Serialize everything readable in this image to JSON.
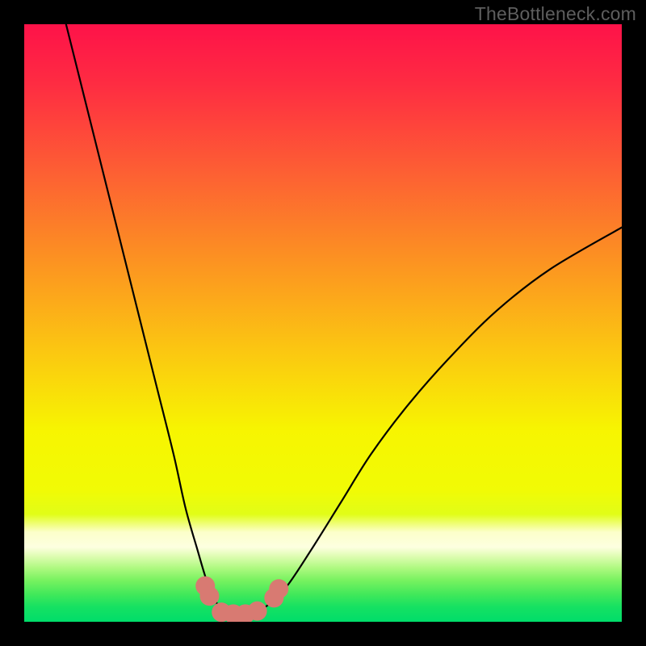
{
  "watermark": "TheBottleneck.com",
  "chart_data": {
    "type": "line",
    "title": "",
    "xlabel": "",
    "ylabel": "",
    "xlim": [
      0,
      100
    ],
    "ylim": [
      0,
      100
    ],
    "grid": false,
    "legend": false,
    "series": [
      {
        "name": "bottleneck-curve",
        "x": [
          7,
          10,
          13,
          16,
          19,
          22,
          25,
          27,
          29,
          30.5,
          32,
          33.5,
          35,
          37,
          39,
          41,
          44,
          48,
          53,
          58,
          64,
          71,
          79,
          88,
          100
        ],
        "y": [
          100,
          88,
          76,
          64,
          52,
          40,
          28,
          19,
          12,
          7,
          3.5,
          1.5,
          1.2,
          1.2,
          1.6,
          3.0,
          6,
          12,
          20,
          28,
          36,
          44,
          52,
          59,
          66
        ]
      }
    ],
    "markers": [
      {
        "name": "flat-zone-left-a",
        "x": 30.3,
        "y": 6.0
      },
      {
        "name": "flat-zone-left-b",
        "x": 31.0,
        "y": 4.3
      },
      {
        "name": "flat-zone-mid-a",
        "x": 33.0,
        "y": 1.6
      },
      {
        "name": "flat-zone-mid-b",
        "x": 35.0,
        "y": 1.3
      },
      {
        "name": "flat-zone-mid-c",
        "x": 37.0,
        "y": 1.3
      },
      {
        "name": "flat-zone-mid-d",
        "x": 39.0,
        "y": 1.8
      },
      {
        "name": "flat-zone-right-a",
        "x": 41.8,
        "y": 4.0
      },
      {
        "name": "flat-zone-right-b",
        "x": 42.6,
        "y": 5.5
      }
    ],
    "marker_color": "#d87a72",
    "marker_radius": 12,
    "gradient_stops": [
      {
        "offset": 0.0,
        "color": "#fe1249"
      },
      {
        "offset": 0.1,
        "color": "#fe2c42"
      },
      {
        "offset": 0.25,
        "color": "#fd6033"
      },
      {
        "offset": 0.4,
        "color": "#fc9421"
      },
      {
        "offset": 0.55,
        "color": "#fbc811"
      },
      {
        "offset": 0.68,
        "color": "#f7f501"
      },
      {
        "offset": 0.78,
        "color": "#f1fb05"
      },
      {
        "offset": 0.82,
        "color": "#e1fd17"
      },
      {
        "offset": 0.85,
        "color": "#fcffca"
      },
      {
        "offset": 0.875,
        "color": "#fdffe0"
      },
      {
        "offset": 0.89,
        "color": "#dffdb3"
      },
      {
        "offset": 0.91,
        "color": "#aef980"
      },
      {
        "offset": 0.93,
        "color": "#79f260"
      },
      {
        "offset": 0.955,
        "color": "#3fe85a"
      },
      {
        "offset": 0.975,
        "color": "#16e162"
      },
      {
        "offset": 1.0,
        "color": "#00dd6a"
      }
    ]
  }
}
